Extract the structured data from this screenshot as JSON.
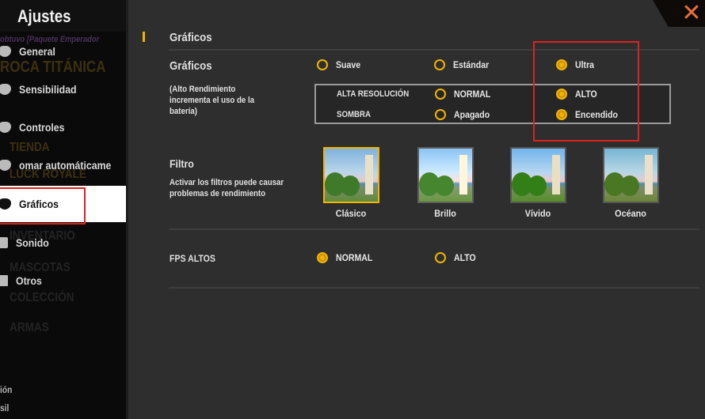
{
  "sidebar": {
    "title": "Ajustes",
    "background_text": [
      "obtuvo [Paquete Emperador",
      "ROCA TITÁNICA",
      "TIENDA",
      "LUCK ROYALE",
      "INVENTARIO",
      "MASCOTAS",
      "COLECCIÓN",
      "ARMAS",
      "ión",
      "sil"
    ],
    "items": [
      {
        "label": "General",
        "icon": "back-arrow-icon"
      },
      {
        "label": "Sensibilidad",
        "icon": "gamepad-icon"
      },
      {
        "label": "Controles",
        "icon": "gamepad-icon"
      },
      {
        "label": "omar automáticame",
        "icon": "gamepad-icon"
      },
      {
        "label": "Gráficos",
        "icon": "gamepad-icon",
        "selected": true
      },
      {
        "label": "Sonido",
        "icon": "music-icon"
      },
      {
        "label": "Otros",
        "icon": "document-icon"
      }
    ]
  },
  "main": {
    "section_title": "Gráficos",
    "graphics": {
      "label": "Gráficos",
      "note": [
        "(Alto Rendimiento",
        "incrementa el uso de la",
        "batería)"
      ],
      "options": [
        "Suave",
        "Estándar",
        "Ultra"
      ],
      "selected": "Ultra",
      "high_res": {
        "label": "ALTA RESOLUCIÓN",
        "options": [
          "NORMAL",
          "ALTO"
        ],
        "selected": "ALTO"
      },
      "shadow": {
        "label": "SOMBRA",
        "options": [
          "Apagado",
          "Encendido"
        ],
        "selected": "Encendido"
      }
    },
    "filter": {
      "label": "Filtro",
      "note": [
        "Activar los filtros puede causar",
        "problemas de rendimiento"
      ],
      "options": [
        "Clásico",
        "Brillo",
        "Vívido",
        "Océano"
      ],
      "selected": "Clásico"
    },
    "fps": {
      "label": "FPS ALTOS",
      "options": [
        "NORMAL",
        "ALTO"
      ],
      "selected": "NORMAL"
    }
  },
  "colors": {
    "accent": "#f0b400",
    "highlight_box": "#e02020",
    "close": "#e8703a"
  },
  "close_icon": "close-icon"
}
